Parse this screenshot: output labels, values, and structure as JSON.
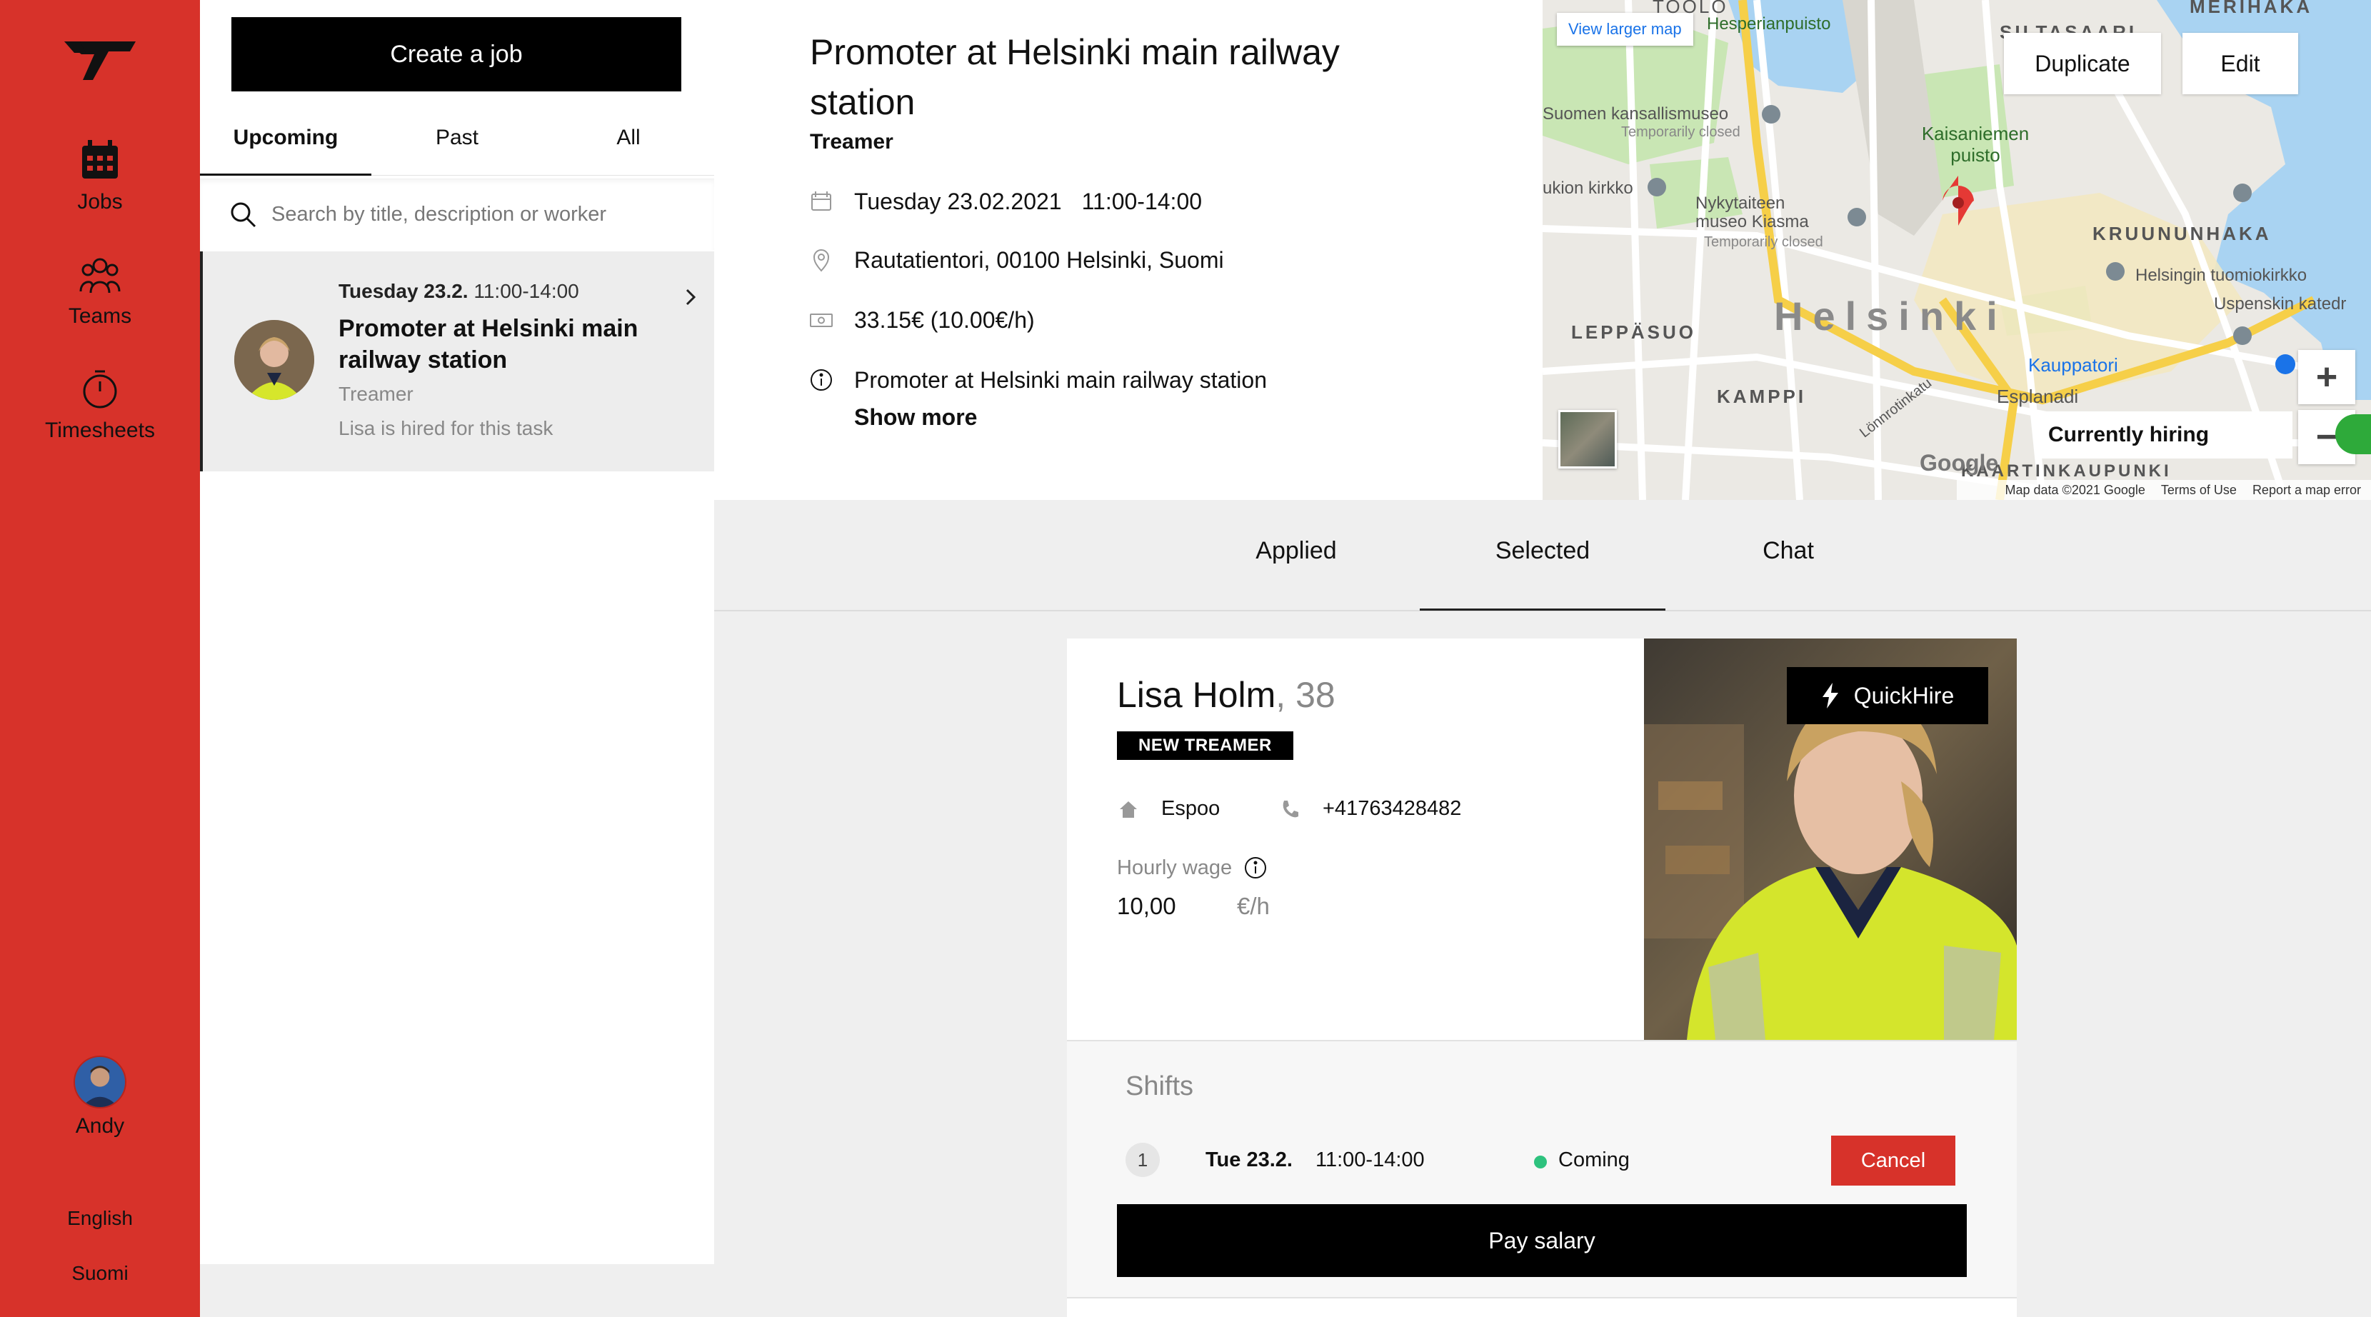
{
  "colors": {
    "brand_red": "#d7322a",
    "black": "#000000",
    "toggle_on": "#2eaa3a",
    "status_green": "#2ec27e"
  },
  "nav": {
    "items": [
      {
        "label": "Jobs",
        "icon": "calendar-icon"
      },
      {
        "label": "Teams",
        "icon": "team-icon"
      },
      {
        "label": "Timesheets",
        "icon": "timer-icon"
      }
    ],
    "user_name": "Andy",
    "languages": [
      "English",
      "Suomi"
    ]
  },
  "list": {
    "create_label": "Create a job",
    "tabs": [
      "Upcoming",
      "Past",
      "All"
    ],
    "active_tab": "Upcoming",
    "search_placeholder": "Search by title, description or worker",
    "jobs": [
      {
        "date": "Tuesday 23.2.",
        "time": "11:00-14:00",
        "title": "Promoter at Helsinki main railway station",
        "company": "Treamer",
        "status": "Lisa is hired for this task"
      }
    ]
  },
  "job": {
    "title": "Promoter at Helsinki main railway station",
    "company": "Treamer",
    "date": "Tuesday 23.02.2021",
    "time": "11:00-14:00",
    "address": "Rautatientori, 00100 Helsinki, Suomi",
    "pay": "33.15€ (10.00€/h)",
    "description": "Promoter at Helsinki main railway station",
    "show_more": "Show more",
    "duplicate_label": "Duplicate",
    "edit_label": "Edit"
  },
  "map": {
    "view_larger": "View larger map",
    "labels": {
      "toolo": "TOOLO",
      "sitasaari": "SILTASAARI",
      "merihaka": "MERIHAKA",
      "hesperian": "Hesperianpuisto",
      "museum": "Suomen kansallismuseo",
      "museum_note": "Temporarily closed",
      "kaisaniemi": "Kaisaniemen puisto",
      "kirkko": "ukion kirkko",
      "kiasma": "Nykytaiteen museo Kiasma",
      "kiasma_note": "Temporarily closed",
      "kruununhaka": "KRUUNUNHAKA",
      "tuomiokirkko": "Helsingin tuomiokirkko",
      "uspenski": "Uspenskin katedr",
      "leppasuo": "LEPPÄSUO",
      "helsinki": "Helsinki",
      "kamppi": "KAMPPI",
      "kauppatori": "Kauppatori",
      "esplanadi": "Esplanadi",
      "lonnrotinkatu": "Lönnrotinkatu",
      "kaartinkaupunki": "KAARTINKAUPUNKI"
    },
    "google": "Google",
    "map_data": "Map data ©2021 Google",
    "terms": "Terms of Use",
    "report": "Report a map error",
    "hiring_label": "Currently hiring",
    "hiring_on": true,
    "zoom_in": "+",
    "zoom_out": "−"
  },
  "candidate_tabs": [
    "Applied",
    "Selected",
    "Chat"
  ],
  "active_candidate_tab": "Selected",
  "worker": {
    "name": "Lisa Holm",
    "age": ", 38",
    "badge": "NEW TREAMER",
    "city": "Espoo",
    "phone": "+41763428482",
    "wage_label": "Hourly wage",
    "wage_value": "10,00",
    "wage_unit": "€/h",
    "quickhire_label": "QuickHire"
  },
  "shifts": {
    "title": "Shifts",
    "rows": [
      {
        "index": "1",
        "date": "Tue 23.2.",
        "time": "11:00-14:00",
        "status": "Coming",
        "cancel": "Cancel"
      }
    ],
    "pay_label": "Pay salary"
  }
}
